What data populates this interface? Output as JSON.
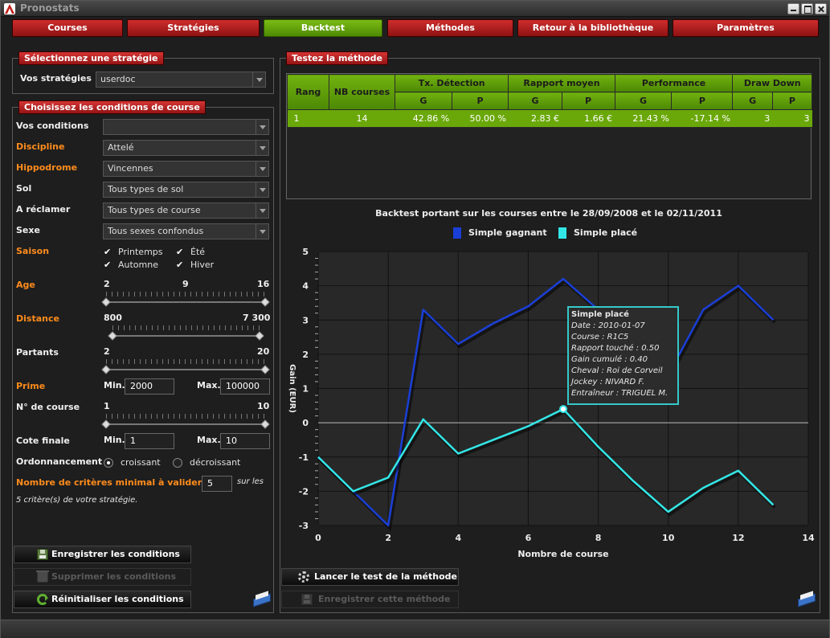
{
  "window": {
    "title": "Pronostats"
  },
  "tabs": [
    {
      "label": "Courses",
      "active": false
    },
    {
      "label": "Stratégies",
      "active": false
    },
    {
      "label": "Backtest",
      "active": true
    },
    {
      "label": "Méthodes",
      "active": false
    },
    {
      "label": "Retour à la bibliothèque",
      "active": false
    },
    {
      "label": "Paramètres",
      "active": false
    }
  ],
  "strategy_panel": {
    "title": "Sélectionnez une stratégie",
    "label": "Vos stratégies",
    "value": "userdoc"
  },
  "conditions_panel": {
    "title": "Choisissez les conditions de course",
    "vos_conditions": {
      "label": "Vos conditions",
      "value": ""
    },
    "discipline": {
      "label": "Discipline",
      "value": "Attelé"
    },
    "hippodrome": {
      "label": "Hippodrome",
      "value": "Vincennes"
    },
    "sol": {
      "label": "Sol",
      "value": "Tous types de sol"
    },
    "reclamer": {
      "label": "A réclamer",
      "value": "Tous types de course"
    },
    "sexe": {
      "label": "Sexe",
      "value": "Tous sexes confondus"
    },
    "saison": {
      "label": "Saison",
      "options": [
        "Printemps",
        "Été",
        "Automne",
        "Hiver"
      ],
      "checked": [
        true,
        true,
        true,
        true
      ]
    },
    "age": {
      "label": "Age",
      "min": "2",
      "mid": "9",
      "max": "16",
      "low_fraction": 0.0,
      "high_fraction": 1.0
    },
    "distance": {
      "label": "Distance",
      "min": "800",
      "max": "7 300",
      "low_fraction": 0.0,
      "high_fraction": 1.0
    },
    "partants": {
      "label": "Partants",
      "min": "2",
      "max": "20",
      "low_fraction": 0.0,
      "high_fraction": 1.0
    },
    "prime": {
      "label": "Prime",
      "min_label": "Min.",
      "min_value": "2000",
      "max_label": "Max.",
      "max_value": "100000"
    },
    "num_course": {
      "label": "N° de course",
      "min": "1",
      "max": "10",
      "low_fraction": 0.0,
      "high_fraction": 1.0
    },
    "cote": {
      "label": "Cote finale",
      "min_label": "Min.",
      "min_value": "1",
      "max_label": "Max.",
      "max_value": "10"
    },
    "ordre": {
      "label": "Ordonnancement",
      "options": [
        "croissant",
        "décroissant"
      ],
      "selected": 0
    },
    "criteres": {
      "label": "Nombre de critères minimal à valider :",
      "value": "5",
      "suffix": "sur les",
      "line2": "5 critère(s) de votre stratégie."
    },
    "buttons": {
      "save": "Enregistrer les conditions",
      "delete": "Supprimer les conditions",
      "reset": "Réinitialiser les conditions"
    }
  },
  "method_panel": {
    "title": "Testez la méthode",
    "table": {
      "headers": {
        "rang": "Rang",
        "nb": "NB courses",
        "detection": "Tx. Détection",
        "rapport": "Rapport moyen",
        "performance": "Performance",
        "drawdown": "Draw Down",
        "g": "G",
        "p": "P"
      },
      "rows": [
        {
          "rang": "1",
          "nb": "14",
          "det_g": "42.86 %",
          "det_p": "50.00 %",
          "rap_g": "2.83 €",
          "rap_p": "1.66 €",
          "perf_g": "21.43 %",
          "perf_p": "-17.14 %",
          "dd_g": "3",
          "dd_p": "3"
        }
      ]
    },
    "buttons": {
      "launch": "Lancer le test de la méthode",
      "save": "Enregistrer cette méthode"
    }
  },
  "tooltip": {
    "title": "Simple placé",
    "lines": [
      "Date : 2010-01-07",
      "Course : R1C5",
      "Rapport touché : 0.50",
      "Gain cumulé : 0.40",
      "Cheval : Roi de Corveil",
      "Jockey : NIVARD F.",
      "Entraîneur : TRIGUEL M."
    ]
  },
  "chart_data": {
    "type": "line",
    "title": "Backtest portant sur les courses entre le 28/09/2008 et le 02/11/2011",
    "xlabel": "Nombre de course",
    "ylabel": "Gain (EUR)",
    "xlim": [
      0,
      14
    ],
    "ylim": [
      -3,
      5
    ],
    "xticks": [
      0,
      2,
      4,
      6,
      8,
      10,
      12,
      14
    ],
    "yticks": [
      -3,
      -2,
      -1,
      0,
      1,
      2,
      3,
      4,
      5
    ],
    "grid": true,
    "legend": "top-center",
    "series": [
      {
        "name": "Simple gagnant",
        "color": "#1a3fd6",
        "x": [
          0,
          1,
          2,
          3,
          4,
          5,
          6,
          7,
          8,
          9,
          10,
          11,
          12,
          13
        ],
        "y": [
          -1,
          -2,
          -3,
          3.3,
          2.3,
          2.9,
          3.4,
          4.2,
          3.3,
          2.1,
          1.4,
          3.3,
          4.0,
          3.0
        ]
      },
      {
        "name": "Simple placé",
        "color": "#33e6e6",
        "x": [
          0,
          1,
          2,
          3,
          4,
          5,
          6,
          7,
          8,
          9,
          10,
          11,
          12,
          13
        ],
        "y": [
          -1,
          -2,
          -1.6,
          0.1,
          -0.9,
          -0.5,
          -0.1,
          0.4,
          -0.7,
          -1.7,
          -2.6,
          -1.9,
          -1.4,
          -2.4
        ]
      }
    ]
  }
}
